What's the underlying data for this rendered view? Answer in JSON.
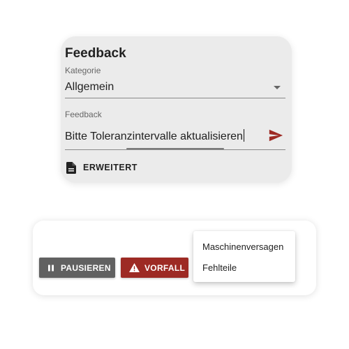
{
  "feedback_card": {
    "title": "Feedback",
    "category_label": "Kategorie",
    "category_value": "Allgemein",
    "feedback_label": "Feedback",
    "feedback_value": "Bitte Toleranzintervalle aktualisieren",
    "advanced_label": "ERWEITERT",
    "icons": {
      "send": "send-icon",
      "dropdown": "chevron-down-icon",
      "advanced": "document-icon"
    },
    "colors": {
      "send_accent": "#9d2a24"
    }
  },
  "actions_card": {
    "pause_label": "PAUSIEREN",
    "incident_label": "VORFALL",
    "menu_items": [
      "Maschinenversagen",
      "Fehlteile"
    ],
    "icons": {
      "pause": "pause-icon",
      "incident": "warning-icon"
    },
    "colors": {
      "pause_button": "#616161",
      "incident_button": "#9d2a24"
    }
  }
}
